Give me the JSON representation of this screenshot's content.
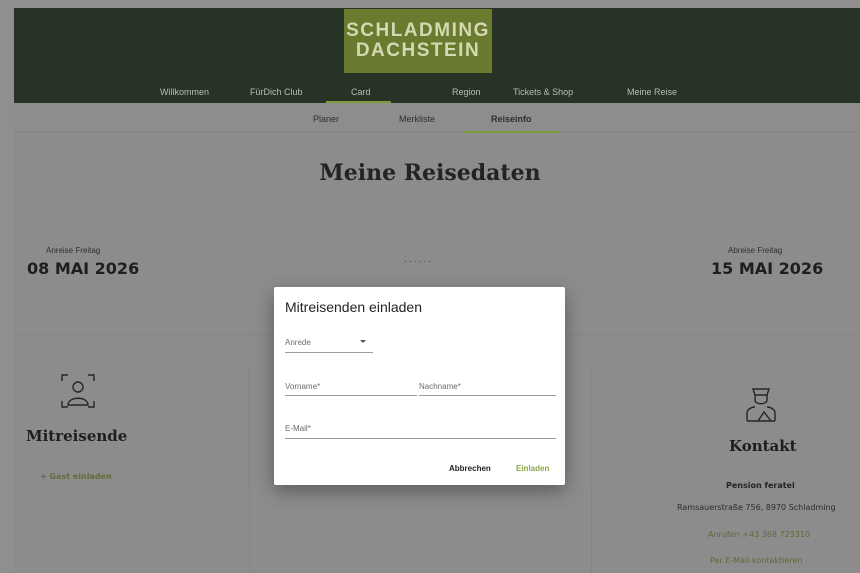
{
  "brand": {
    "logo_line1": "SCHLADMING",
    "logo_line2": "DACHSTEIN"
  },
  "main_nav": [
    "Willkommen",
    "FürDich Club",
    "Card",
    "Region",
    "Tickets & Shop",
    "Meine Reise"
  ],
  "sub_nav": {
    "items": [
      "Planer",
      "Merkliste",
      "Reiseinfo"
    ],
    "active": "Reiseinfo"
  },
  "page": {
    "title": "Meine Reisedaten"
  },
  "arrival": {
    "label": "Anreise Freitag",
    "date": "08 MAI 2026"
  },
  "departure": {
    "label": "Abreise Freitag",
    "date": "15 MAI 2026"
  },
  "dots": "......",
  "travelers": {
    "title": "Mitreisende",
    "invite_label": "+  Gast einladen"
  },
  "contact": {
    "title": "Kontakt",
    "name": "Pension feratel",
    "address": "Ramsauerstraße 756, 8970 Schladming",
    "call": "Anrufen +43 368 723310",
    "email": "Per E-Mail kontaktieren"
  },
  "modal": {
    "title": "Mitreisenden einladen",
    "salutation_placeholder": "Anrede",
    "first_name_placeholder": "Vorname*",
    "last_name_placeholder": "Nachname*",
    "email_placeholder": "E-Mail*",
    "cancel_label": "Abbrechen",
    "invite_label": "Einladen"
  },
  "colors": {
    "topbar": "#273325",
    "accent": "#7e9a3a",
    "modal_bg": "#ffffff",
    "overlay": "#8c8c8c"
  },
  "icons": {
    "traveler": "person-scan-icon",
    "contact": "concierge-icon",
    "dropdown": "chevron-down-icon"
  }
}
